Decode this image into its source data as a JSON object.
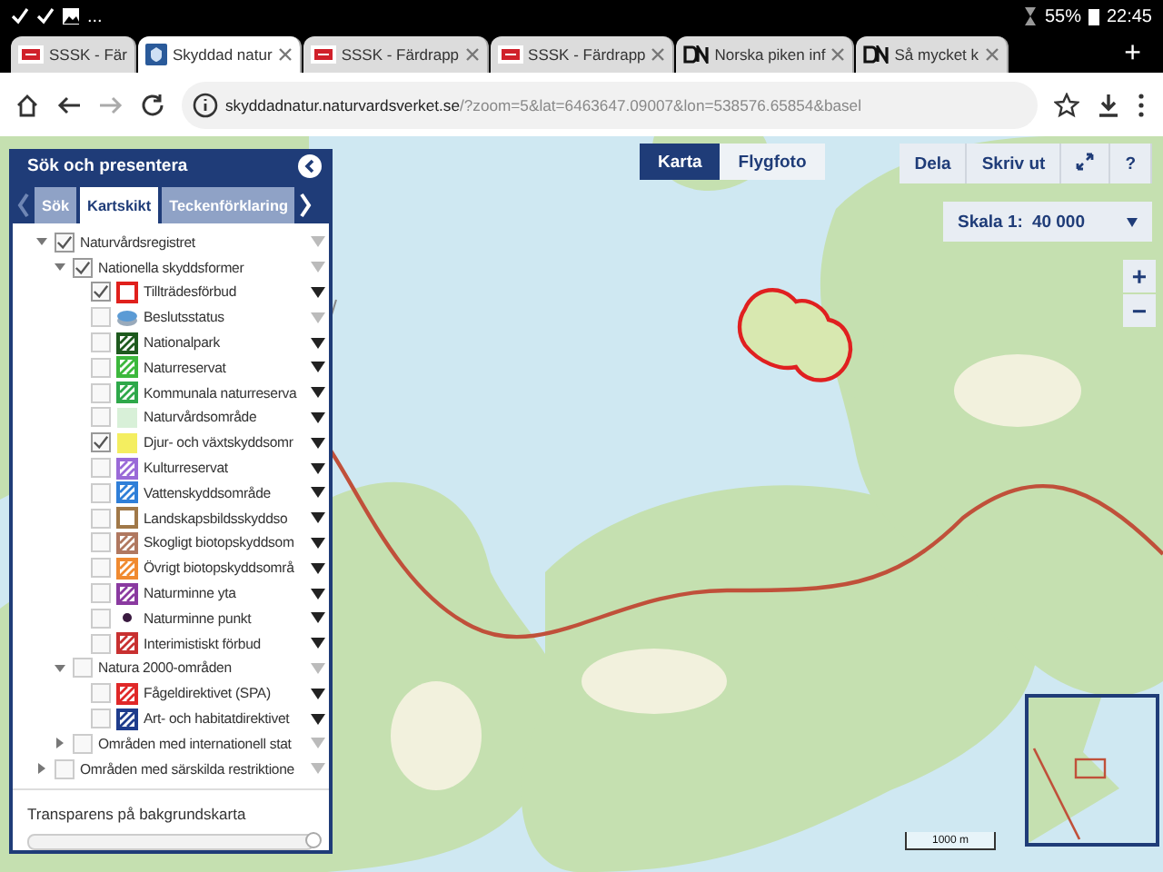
{
  "status_bar": {
    "notifications": "...",
    "battery": "55%",
    "time": "22:45"
  },
  "browser_tabs": [
    {
      "kind": "flag",
      "title": "SSSK - Fär",
      "selected": false
    },
    {
      "kind": "shield",
      "title": "Skyddad natur",
      "selected": true
    },
    {
      "kind": "flag",
      "title": "SSSK - Färdrapp",
      "selected": false
    },
    {
      "kind": "flag",
      "title": "SSSK - Färdrapp",
      "selected": false
    },
    {
      "kind": "dn",
      "title": "Norska piken inf",
      "selected": false
    },
    {
      "kind": "dn",
      "title": "Så mycket k",
      "selected": false
    }
  ],
  "new_tab": "+",
  "address": {
    "host": "skyddadnatur.naturvardsverket.se",
    "path": "/?zoom=5&lat=6463647.09007&lon=538576.65854&basel"
  },
  "panel": {
    "title": "Sök och presentera",
    "tabs": [
      {
        "label": "Sök",
        "selected": false
      },
      {
        "label": "Kartskikt",
        "selected": true
      },
      {
        "label": "Teckenförklaring",
        "selected": false
      }
    ],
    "tree": [
      {
        "label": "Naturvårdsregistret",
        "checked": true,
        "expanded": true,
        "menu_enabled": false,
        "children": [
          {
            "label": "Nationella skyddsformer",
            "checked": true,
            "expanded": true,
            "menu_enabled": false,
            "children": [
              {
                "label": "Tillträdesförbud",
                "checked": true,
                "menu_enabled": true,
                "swatch": {
                  "kind": "outline",
                  "color": "#e0201c"
                }
              },
              {
                "label": "Beslutsstatus",
                "checked": false,
                "menu_enabled": false,
                "swatch": {
                  "kind": "stack",
                  "color": "#5b9bd5"
                }
              },
              {
                "label": "Nationalpark",
                "checked": false,
                "menu_enabled": true,
                "swatch": {
                  "kind": "hatch",
                  "color": "#1e5a1e"
                }
              },
              {
                "label": "Naturreservat",
                "checked": false,
                "menu_enabled": true,
                "swatch": {
                  "kind": "hatch",
                  "color": "#3cb83c"
                }
              },
              {
                "label": "Kommunala naturreserva",
                "checked": false,
                "menu_enabled": true,
                "swatch": {
                  "kind": "hatch",
                  "color": "#2ea84a"
                }
              },
              {
                "label": "Naturvårdsområde",
                "checked": false,
                "menu_enabled": true,
                "swatch": {
                  "kind": "fill",
                  "color": "#d8f0d8"
                }
              },
              {
                "label": "Djur- och växtskyddsomr",
                "checked": true,
                "menu_enabled": true,
                "swatch": {
                  "kind": "fill",
                  "color": "#f4ee60"
                }
              },
              {
                "label": "Kulturreservat",
                "checked": false,
                "menu_enabled": true,
                "swatch": {
                  "kind": "hatch",
                  "color": "#9a6ad8"
                }
              },
              {
                "label": "Vattenskyddsområde",
                "checked": false,
                "menu_enabled": true,
                "swatch": {
                  "kind": "hatch",
                  "color": "#2f7fd8"
                }
              },
              {
                "label": "Landskapsbildsskyddso",
                "checked": false,
                "menu_enabled": true,
                "swatch": {
                  "kind": "outline",
                  "color": "#a07848"
                }
              },
              {
                "label": "Skogligt biotopskyddsom",
                "checked": false,
                "menu_enabled": true,
                "swatch": {
                  "kind": "hatch",
                  "color": "#b07860"
                }
              },
              {
                "label": "Övrigt biotopskyddsområ",
                "checked": false,
                "menu_enabled": true,
                "swatch": {
                  "kind": "hatch",
                  "color": "#f08a30"
                }
              },
              {
                "label": "Naturminne yta",
                "checked": false,
                "menu_enabled": true,
                "swatch": {
                  "kind": "hatch",
                  "color": "#8a3aa0"
                }
              },
              {
                "label": "Naturminne punkt",
                "checked": false,
                "menu_enabled": true,
                "swatch": {
                  "kind": "dot",
                  "color": "#3a1a40"
                }
              },
              {
                "label": "Interimistiskt förbud",
                "checked": false,
                "menu_enabled": true,
                "swatch": {
                  "kind": "hatch",
                  "color": "#c83030"
                }
              }
            ]
          },
          {
            "label": "Natura 2000-områden",
            "checked": false,
            "expanded": true,
            "menu_enabled": false,
            "children": [
              {
                "label": "Fågeldirektivet (SPA)",
                "checked": false,
                "menu_enabled": true,
                "swatch": {
                  "kind": "hatch",
                  "color": "#e02828"
                }
              },
              {
                "label": "Art- och habitatdirektivet",
                "checked": false,
                "menu_enabled": true,
                "swatch": {
                  "kind": "hatch",
                  "color": "#1e3c8c"
                }
              }
            ]
          },
          {
            "label": "Områden med internationell stat",
            "checked": false,
            "expanded": false,
            "menu_enabled": false
          }
        ]
      },
      {
        "label": "Områden med särskilda restriktione",
        "checked": false,
        "expanded": false,
        "menu_enabled": false
      }
    ],
    "transparency": {
      "label": "Transparens på bakgrundskarta",
      "level": 1
    }
  },
  "map": {
    "modes": [
      {
        "label": "Karta",
        "selected": true
      },
      {
        "label": "Flygfoto",
        "selected": false
      }
    ],
    "actions": [
      "Dela",
      "Skriv ut"
    ],
    "help": "?",
    "scale_label": "Skala 1:",
    "scale": "40 000",
    "zoom_in": "+",
    "zoom_out": "−",
    "scale_bar": "1000 m"
  }
}
